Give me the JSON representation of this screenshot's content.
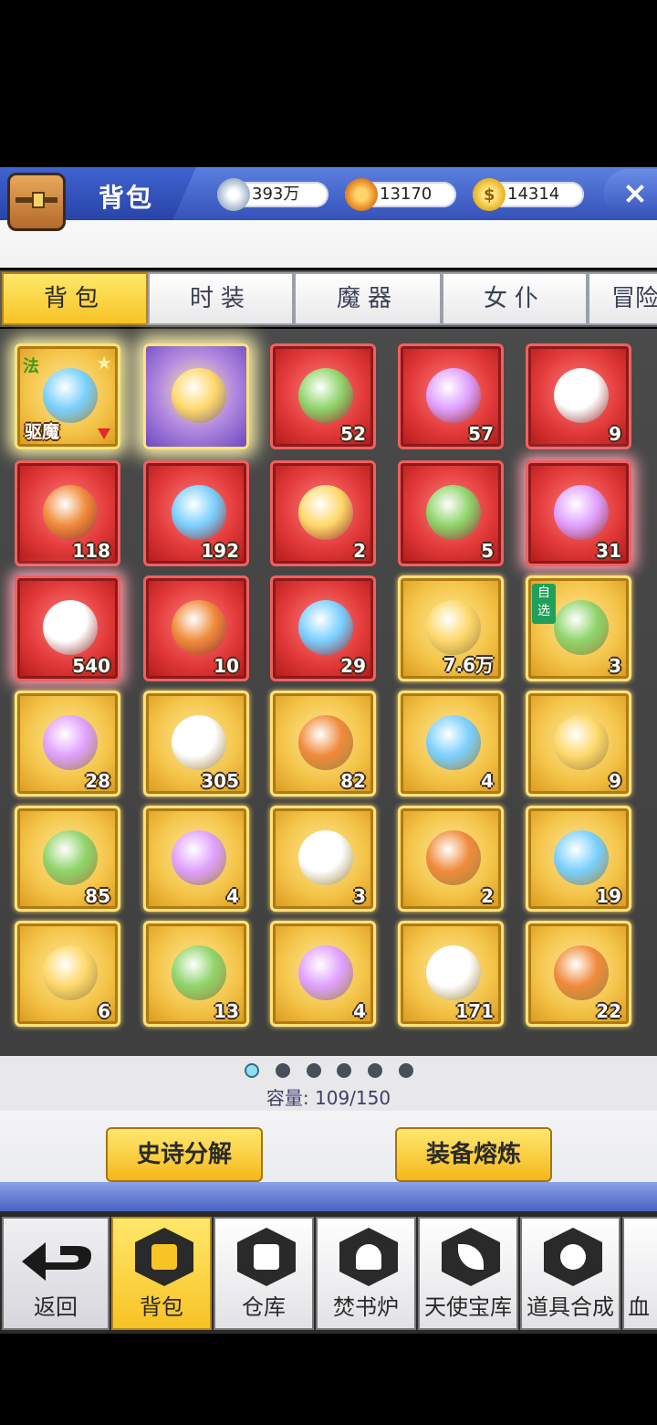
{
  "header": {
    "title": "背包",
    "currencies": [
      {
        "icon": "diamond-icon",
        "value": "393万"
      },
      {
        "icon": "badge-icon",
        "value": "13170"
      },
      {
        "icon": "gold-coin-icon",
        "value": "14314"
      }
    ]
  },
  "tabs": [
    "背包",
    "时装",
    "魔器",
    "女仆",
    "冒险"
  ],
  "items": [
    {
      "count": "",
      "tag": "法",
      "label": "驱魔",
      "style": "gold"
    },
    {
      "count": "",
      "style": "purpleglow"
    },
    {
      "count": "52",
      "icon": "pencil-icon",
      "style": "red"
    },
    {
      "count": "57",
      "icon": "scroll-icon",
      "style": "red"
    },
    {
      "count": "9",
      "icon": "bowl-icon",
      "style": "red"
    },
    {
      "count": "118",
      "icon": "medal-icon",
      "style": "red"
    },
    {
      "count": "192",
      "icon": "map-scroll-icon",
      "style": "red"
    },
    {
      "count": "2",
      "icon": "crystal-shard-icon",
      "style": "red"
    },
    {
      "count": "5",
      "icon": "orb-icon",
      "style": "red"
    },
    {
      "count": "31",
      "icon": "red-gem-icon",
      "style": "redglow"
    },
    {
      "count": "540",
      "icon": "gold-gem-icon",
      "style": "redglow"
    },
    {
      "count": "10",
      "icon": "shell-icon",
      "style": "red"
    },
    {
      "count": "29",
      "icon": "armor-icon",
      "style": "red"
    },
    {
      "count": "7.6万",
      "icon": "ore-icon",
      "style": "gold"
    },
    {
      "count": "3",
      "tag": "自选",
      "icon": "scroll-bundle-icon",
      "style": "gold"
    },
    {
      "count": "28",
      "icon": "parchment-icon",
      "style": "gold"
    },
    {
      "count": "305",
      "icon": "moon-icon",
      "style": "gold"
    },
    {
      "count": "82",
      "icon": "dice-icon",
      "style": "gold"
    },
    {
      "count": "4",
      "icon": "dice-pair-icon",
      "style": "gold"
    },
    {
      "count": "9",
      "icon": "ticket-icon",
      "style": "gold"
    },
    {
      "count": "85",
      "icon": "gem-ring-icon",
      "style": "gold"
    },
    {
      "count": "4",
      "icon": "bat-orb-icon",
      "style": "gold"
    },
    {
      "count": "3",
      "icon": "dark-shard-icon",
      "style": "gold"
    },
    {
      "count": "2",
      "icon": "blue-shard-icon",
      "style": "gold"
    },
    {
      "count": "19",
      "icon": "puzzle-icon",
      "style": "gold"
    },
    {
      "count": "6",
      "icon": "puzzle-green-icon",
      "style": "gold"
    },
    {
      "count": "13",
      "icon": "emerald-icon",
      "style": "gold"
    },
    {
      "count": "4",
      "icon": "gold-nuggets-icon",
      "style": "gold"
    },
    {
      "count": "171",
      "icon": "purple-orb-icon",
      "style": "gold"
    },
    {
      "count": "22",
      "icon": "gold-bar-icon",
      "style": "gold"
    }
  ],
  "pager": {
    "pages": 6,
    "current": 1
  },
  "capacity": "容量: 109/150",
  "actions": {
    "decompose": "史诗分解",
    "smelt": "装备熔炼"
  },
  "nav": [
    "返回",
    "背包",
    "仓库",
    "焚书炉",
    "天使宝库",
    "道具合成",
    "血(cut off)"
  ]
}
